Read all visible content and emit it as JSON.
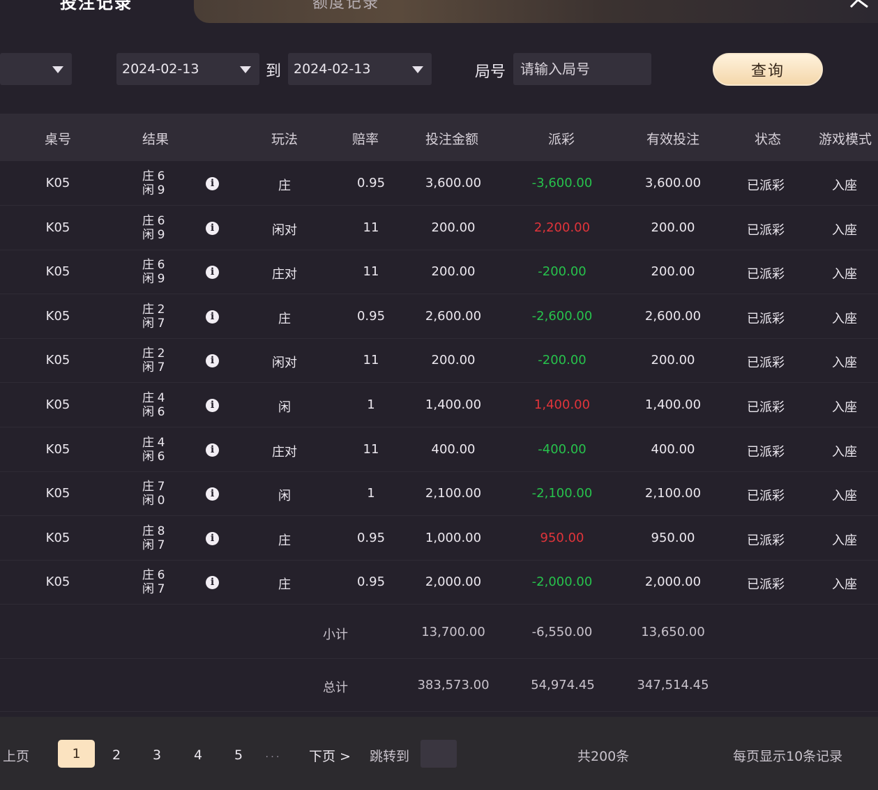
{
  "tabs": {
    "active": "投注记录",
    "inactive": "额度记录"
  },
  "filters": {
    "date_from": "2024-02-13",
    "date_to": "2024-02-13",
    "to_label": "到",
    "round_label": "局号",
    "round_placeholder": "请输入局号",
    "query_label": "查询"
  },
  "table": {
    "headers": [
      "桌号",
      "结果",
      "玩法",
      "赔率",
      "投注金额",
      "派彩",
      "有效投注",
      "状态",
      "游戏模式"
    ],
    "banker_label": "庄",
    "player_label": "闲",
    "rows": [
      {
        "table": "K05",
        "banker": "6",
        "player": "9",
        "play": "庄",
        "odds": "0.95",
        "bet": "3,600.00",
        "payout": "-3,600.00",
        "valid": "3,600.00",
        "status": "已派彩",
        "mode": "入座"
      },
      {
        "table": "K05",
        "banker": "6",
        "player": "9",
        "play": "闲对",
        "odds": "11",
        "bet": "200.00",
        "payout": "2,200.00",
        "valid": "200.00",
        "status": "已派彩",
        "mode": "入座"
      },
      {
        "table": "K05",
        "banker": "6",
        "player": "9",
        "play": "庄对",
        "odds": "11",
        "bet": "200.00",
        "payout": "-200.00",
        "valid": "200.00",
        "status": "已派彩",
        "mode": "入座"
      },
      {
        "table": "K05",
        "banker": "2",
        "player": "7",
        "play": "庄",
        "odds": "0.95",
        "bet": "2,600.00",
        "payout": "-2,600.00",
        "valid": "2,600.00",
        "status": "已派彩",
        "mode": "入座"
      },
      {
        "table": "K05",
        "banker": "2",
        "player": "7",
        "play": "闲对",
        "odds": "11",
        "bet": "200.00",
        "payout": "-200.00",
        "valid": "200.00",
        "status": "已派彩",
        "mode": "入座"
      },
      {
        "table": "K05",
        "banker": "4",
        "player": "6",
        "play": "闲",
        "odds": "1",
        "bet": "1,400.00",
        "payout": "1,400.00",
        "valid": "1,400.00",
        "status": "已派彩",
        "mode": "入座"
      },
      {
        "table": "K05",
        "banker": "4",
        "player": "6",
        "play": "庄对",
        "odds": "11",
        "bet": "400.00",
        "payout": "-400.00",
        "valid": "400.00",
        "status": "已派彩",
        "mode": "入座"
      },
      {
        "table": "K05",
        "banker": "7",
        "player": "0",
        "play": "闲",
        "odds": "1",
        "bet": "2,100.00",
        "payout": "-2,100.00",
        "valid": "2,100.00",
        "status": "已派彩",
        "mode": "入座"
      },
      {
        "table": "K05",
        "banker": "8",
        "player": "7",
        "play": "庄",
        "odds": "0.95",
        "bet": "1,000.00",
        "payout": "950.00",
        "valid": "950.00",
        "status": "已派彩",
        "mode": "入座"
      },
      {
        "table": "K05",
        "banker": "6",
        "player": "7",
        "play": "庄",
        "odds": "0.95",
        "bet": "2,000.00",
        "payout": "-2,000.00",
        "valid": "2,000.00",
        "status": "已派彩",
        "mode": "入座"
      }
    ],
    "subtotal": {
      "label": "小计",
      "bet": "13,700.00",
      "payout": "-6,550.00",
      "valid": "13,650.00"
    },
    "total": {
      "label": "总计",
      "bet": "383,573.00",
      "payout": "54,974.45",
      "valid": "347,514.45"
    }
  },
  "pagination": {
    "prev_label": "上页",
    "pages": [
      "1",
      "2",
      "3",
      "4",
      "5"
    ],
    "current": "1",
    "ellipsis": "...",
    "next_label": "下页 >",
    "jump_label": "跳转到",
    "total_label": "共200条",
    "per_page_label": "每页显示10条记录"
  },
  "colors": {
    "negative": "#27c24c",
    "positive": "#e0343a",
    "accent": "#fbe3c0"
  }
}
